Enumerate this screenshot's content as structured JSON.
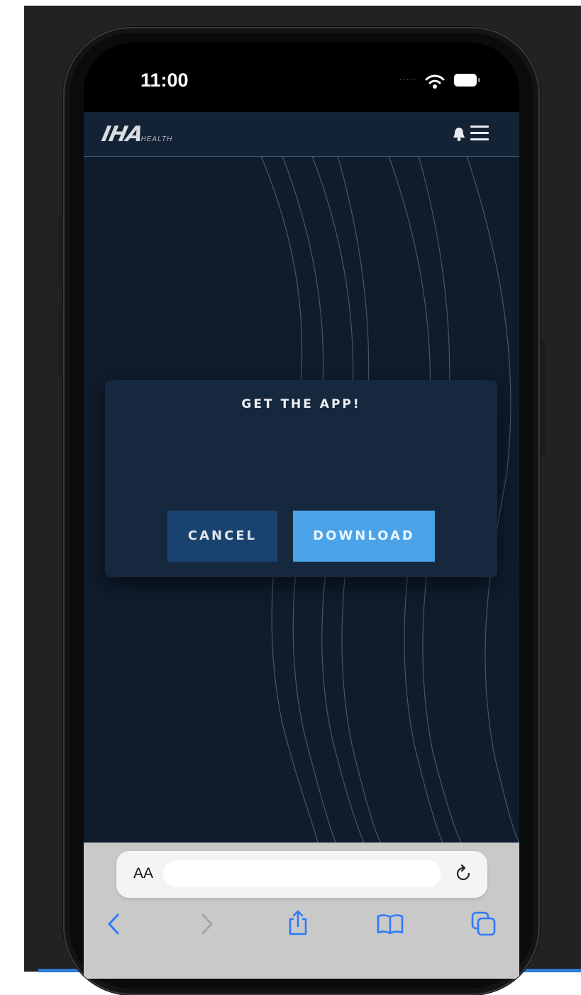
{
  "status_bar": {
    "time": "11:00",
    "signal_dots": "....."
  },
  "site": {
    "logo_mark": "IHA",
    "logo_subtitle": "HEALTH",
    "colors": {
      "background": "#0f1c2d",
      "header": "#142235",
      "accent": "#4aa3e8",
      "cancel": "#19436e"
    }
  },
  "modal": {
    "title": "GET THE APP!",
    "cancel_label": "CANCEL",
    "download_label": "DOWNLOAD"
  },
  "browser": {
    "text_size_label": "AA",
    "url": "",
    "toolbar_icons": [
      "back-icon",
      "forward-icon",
      "share-icon",
      "bookmarks-icon",
      "tabs-icon"
    ]
  }
}
